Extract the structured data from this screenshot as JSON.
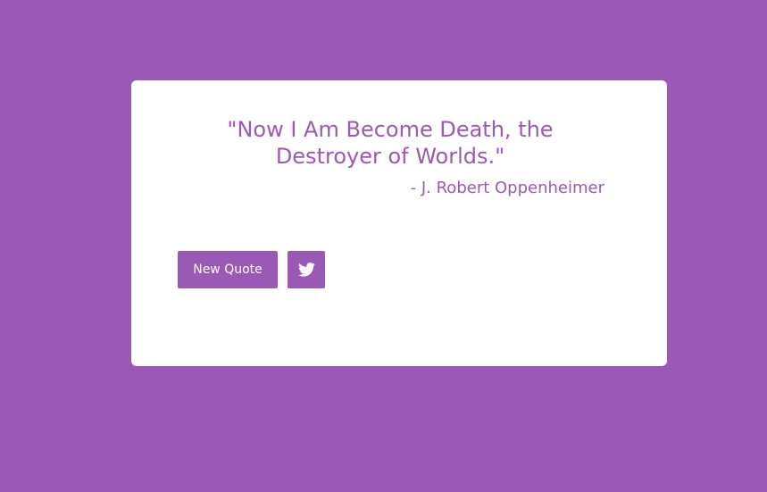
{
  "colors": {
    "background": "#9b59b6",
    "card": "#ffffff",
    "accent": "#9b59b6",
    "button_text": "#ffffff"
  },
  "quote": {
    "text": "\"Now I Am Become Death, the Destroyer of Worlds.\"",
    "author": "- J. Robert Oppenheimer"
  },
  "buttons": {
    "new_quote_label": "New Quote",
    "tweet_icon": "twitter-icon"
  }
}
